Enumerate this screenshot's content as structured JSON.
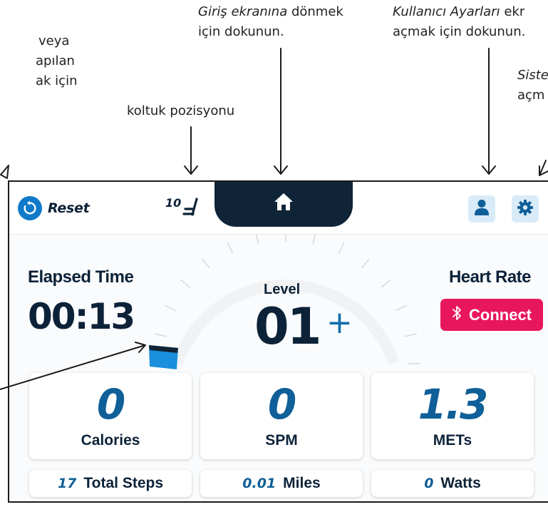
{
  "callouts": {
    "left_line1": "veya",
    "left_line2": "apılan",
    "left_line3": "ak için",
    "seat": "koltuk pozisyonu",
    "home_italic": "Giriş ekranına",
    "home_rest": " dönmek",
    "home_line2": "için dokunun.",
    "user_italic": "Kullanıcı Ayarları",
    "user_rest": " ekr",
    "user_line2": "açmak için dokunun.",
    "system_line1": "Siste",
    "system_line2": "açm"
  },
  "topbar": {
    "reset_label": "Reset",
    "seat_value": "10",
    "reset_icon": "reset-icon",
    "seat_icon": "seat-icon",
    "home_icon": "home-icon",
    "user_icon": "user-icon",
    "settings_icon": "gear-icon"
  },
  "dashboard": {
    "elapsed_title": "Elapsed Time",
    "elapsed_value": "00:13",
    "level_title": "Level",
    "level_value": "01",
    "level_plus": "+",
    "heart_title": "Heart Rate",
    "connect_label": "Connect",
    "connect_icon": "bluetooth-icon"
  },
  "metrics": {
    "calories_value": "0",
    "calories_label": "Calories",
    "spm_value": "0",
    "spm_label": "SPM",
    "mets_value": "1.3",
    "mets_label": "METs"
  },
  "summary": {
    "steps_value": "17",
    "steps_label": "Total Steps",
    "miles_value": "0.01",
    "miles_label": "Miles",
    "watts_value": "0",
    "watts_label": "Watts"
  },
  "colors": {
    "navy": "#0c2238",
    "accent_blue": "#0f7ac9",
    "connect_pink": "#e8175d",
    "button_light": "#d9ebf8"
  }
}
